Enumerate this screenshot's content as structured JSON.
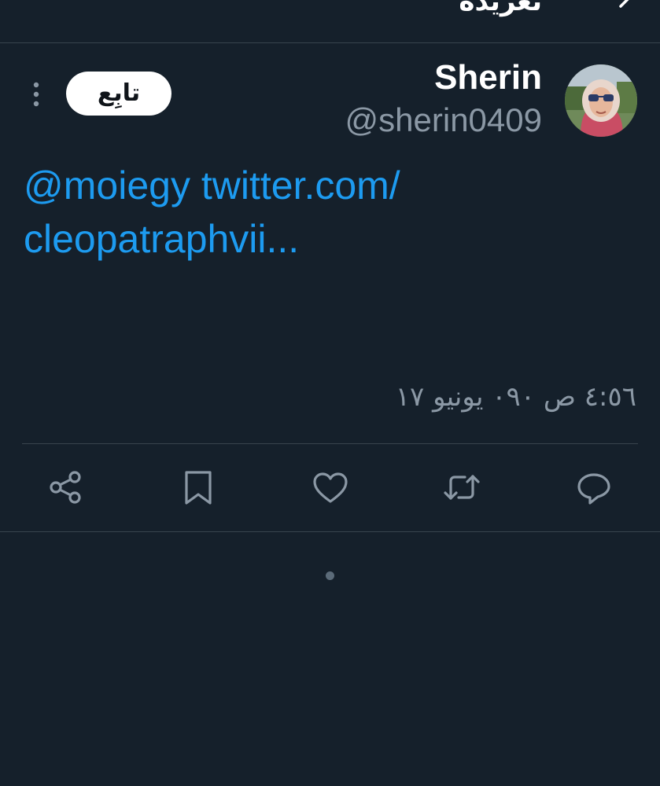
{
  "header": {
    "title": "تغريدة",
    "back_icon": "arrow-right-icon"
  },
  "tweet": {
    "author": {
      "display_name": "Sherin",
      "handle": "@sherin0409",
      "avatar_icon": "avatar-photo"
    },
    "follow_label": "تابِع",
    "more_icon": "more-vertical-icon",
    "text": {
      "mention": "@moiegy",
      "link_line1": "twitter.com/",
      "link_line2": "cleopatraphvii..."
    },
    "timestamp": "٤:٥٦ ص ٠٩٠ يونيو ١٧",
    "actions": [
      {
        "name": "reply",
        "icon": "reply-icon"
      },
      {
        "name": "retweet",
        "icon": "retweet-icon"
      },
      {
        "name": "like",
        "icon": "heart-icon"
      },
      {
        "name": "bookmark",
        "icon": "bookmark-icon"
      },
      {
        "name": "share",
        "icon": "share-icon"
      }
    ]
  },
  "colors": {
    "background": "#15202b",
    "accent": "#1d9bf0",
    "secondary_text": "#8b98a5",
    "divider": "#38444d"
  }
}
